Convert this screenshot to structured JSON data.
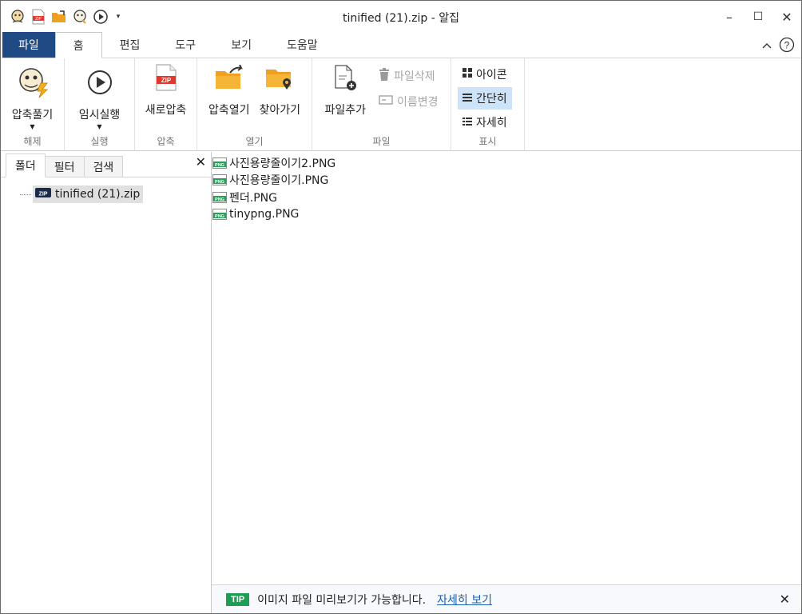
{
  "window": {
    "title": "tinified (21).zip - 알집"
  },
  "quick_access": {
    "items": [
      {
        "icon": "alzip-logo-icon"
      },
      {
        "icon": "zip-new-icon"
      },
      {
        "icon": "folder-open-icon"
      },
      {
        "icon": "extract-icon"
      },
      {
        "icon": "play-icon"
      }
    ],
    "more_label": "▾"
  },
  "window_controls": {
    "minimize": "–",
    "maximize": "☐",
    "close": "✕"
  },
  "ribbon_tabs": {
    "items": [
      {
        "label": "파일"
      },
      {
        "label": "홈"
      },
      {
        "label": "편집"
      },
      {
        "label": "도구"
      },
      {
        "label": "보기"
      },
      {
        "label": "도움말"
      }
    ],
    "collapse_icon": "^",
    "help_label": "?"
  },
  "ribbon": {
    "groups": [
      {
        "label": "해제",
        "buttons": [
          {
            "label": "압축풀기",
            "has_dropdown": true
          }
        ]
      },
      {
        "label": "실행",
        "buttons": [
          {
            "label": "임시실행",
            "has_dropdown": true
          }
        ]
      },
      {
        "label": "압축",
        "buttons": [
          {
            "label": "새로압축"
          }
        ]
      },
      {
        "label": "열기",
        "buttons": [
          {
            "label": "압축열기"
          },
          {
            "label": "찾아가기"
          }
        ]
      },
      {
        "label": "파일",
        "buttons": [
          {
            "label": "파일추가"
          }
        ],
        "small_buttons": [
          {
            "label": "파일삭제",
            "enabled": false
          },
          {
            "label": "이름변경",
            "enabled": false
          }
        ]
      },
      {
        "label": "표시",
        "small_buttons": [
          {
            "label": "아이콘"
          },
          {
            "label": "간단히",
            "selected": true
          },
          {
            "label": "자세히"
          }
        ]
      }
    ]
  },
  "left_pane": {
    "tabs": [
      {
        "label": "폴더"
      },
      {
        "label": "필터"
      },
      {
        "label": "검색"
      }
    ],
    "close_label": "✕",
    "tree": [
      {
        "label": "tinified (21).zip",
        "icon": "zip-archive-icon"
      }
    ]
  },
  "file_list": {
    "items": [
      {
        "name": "사진용량줄이기2.PNG"
      },
      {
        "name": "사진용량줄이기.PNG"
      },
      {
        "name": "펜더.PNG"
      },
      {
        "name": "tinypng.PNG"
      }
    ]
  },
  "tip_bar": {
    "badge": "TIP",
    "text": "이미지 파일 미리보기가 가능합니다.",
    "link": "자세히 보기",
    "close_label": "✕"
  },
  "colors": {
    "file_tab_bg": "#1f4a83",
    "selected_bg": "#cde3f7",
    "tip_badge": "#1e9d55",
    "link": "#1a5fb4",
    "zip_red": "#e2382f",
    "folder_orange": "#f0a020"
  }
}
